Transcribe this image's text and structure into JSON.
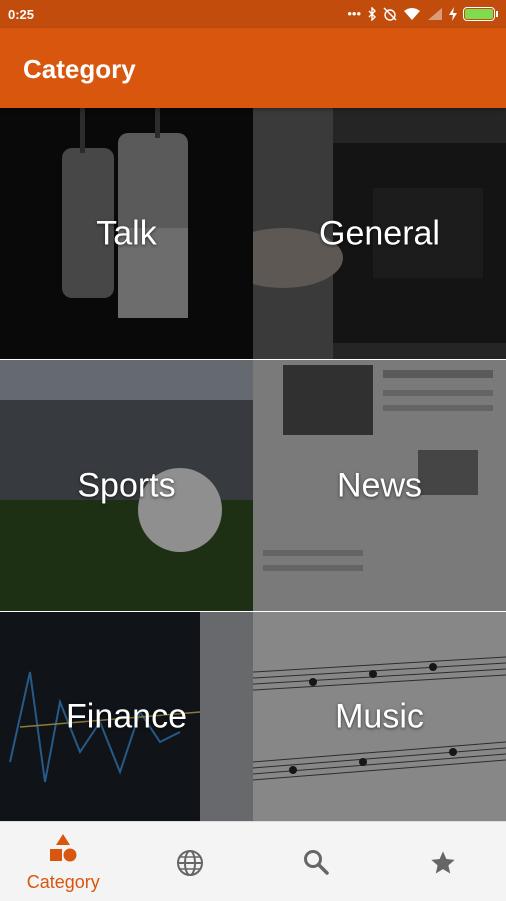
{
  "status": {
    "time": "0:25"
  },
  "appbar": {
    "title": "Category"
  },
  "categories": [
    {
      "label": "Talk"
    },
    {
      "label": "General"
    },
    {
      "label": "Sports"
    },
    {
      "label": "News"
    },
    {
      "label": "Finance"
    },
    {
      "label": "Music"
    }
  ],
  "bottom_nav": {
    "items": [
      {
        "label": "Category",
        "icon": "category-icon",
        "active": true
      },
      {
        "icon": "globe-icon"
      },
      {
        "icon": "search-icon"
      },
      {
        "icon": "star-icon"
      }
    ]
  },
  "colors": {
    "accent": "#d9560e",
    "statusbar": "#c24c0c",
    "active_nav": "#d9560e",
    "inactive_nav": "#666666"
  }
}
